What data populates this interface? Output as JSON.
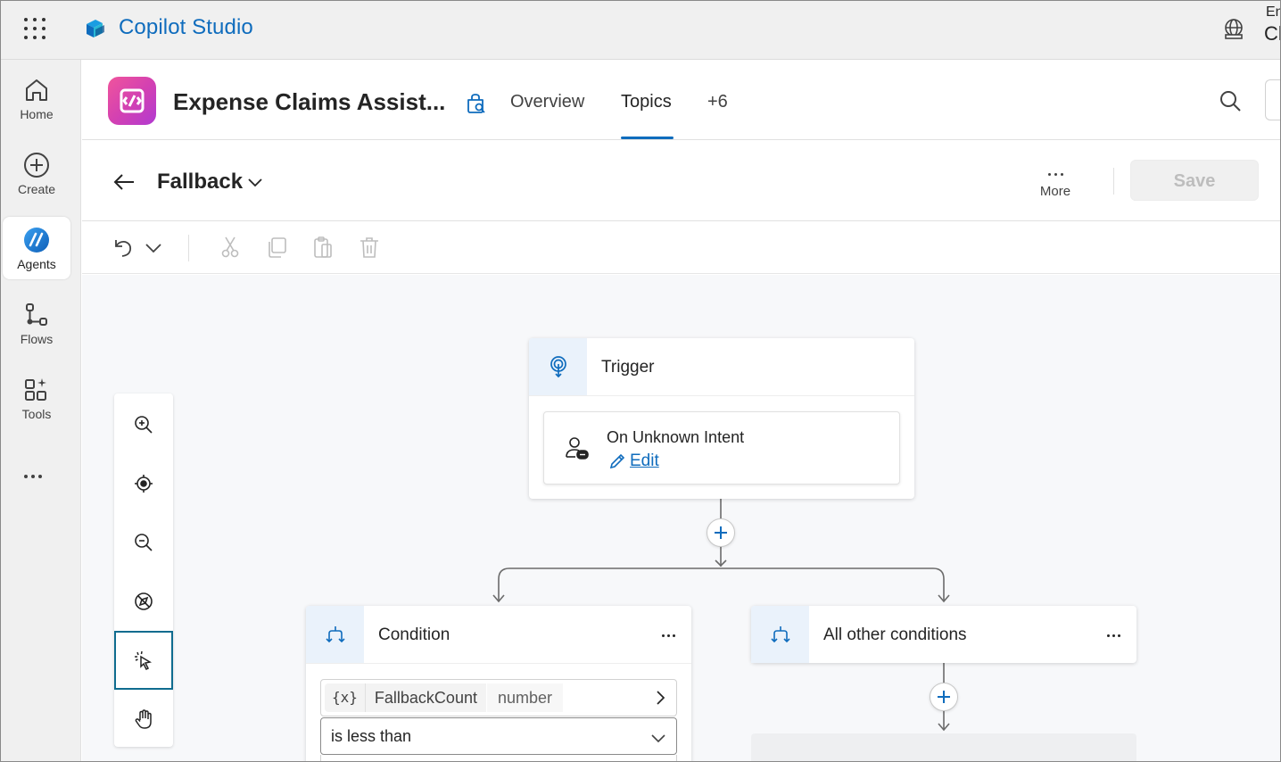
{
  "app": {
    "name": "Copilot Studio",
    "env_line1": "En",
    "env_line2": "Cl"
  },
  "rail": {
    "items": [
      {
        "label": "Home",
        "icon": "home-icon"
      },
      {
        "label": "Create",
        "icon": "add-circle-icon"
      },
      {
        "label": "Agents",
        "icon": "agents-icon",
        "active": true
      },
      {
        "label": "Flows",
        "icon": "flow-icon"
      },
      {
        "label": "Tools",
        "icon": "tools-icon"
      }
    ],
    "more_icon": "more-horizontal-icon"
  },
  "agent": {
    "name": "Expense Claims Assist...",
    "tabs": [
      {
        "label": "Overview"
      },
      {
        "label": "Topics",
        "selected": true
      },
      {
        "label": "+6"
      }
    ]
  },
  "topic": {
    "name": "Fallback",
    "more_label": "More",
    "save_label": "Save"
  },
  "toolbar": {
    "icons": [
      "undo-icon",
      "chevron-down-icon",
      "cut-icon",
      "copy-icon",
      "paste-icon",
      "delete-icon"
    ]
  },
  "canvas": {
    "zoom_controls": [
      "zoom-in-icon",
      "recenter-icon",
      "zoom-out-icon",
      "minimap-off-icon",
      "select-pointer-icon",
      "pan-hand-icon"
    ],
    "trigger": {
      "title": "Trigger",
      "intent_title": "On Unknown Intent",
      "edit_label": "Edit"
    },
    "condition": {
      "title": "Condition",
      "var_token": "{x}",
      "var_name": "FallbackCount",
      "var_type": "number",
      "operator": "is less than"
    },
    "other": {
      "title": "All other conditions"
    }
  },
  "colors": {
    "accent": "#0f6cbd",
    "agent_icon_gradient": [
      "#f0559c",
      "#b13ad1"
    ],
    "node_icon_bg": "#eaf2fb"
  }
}
